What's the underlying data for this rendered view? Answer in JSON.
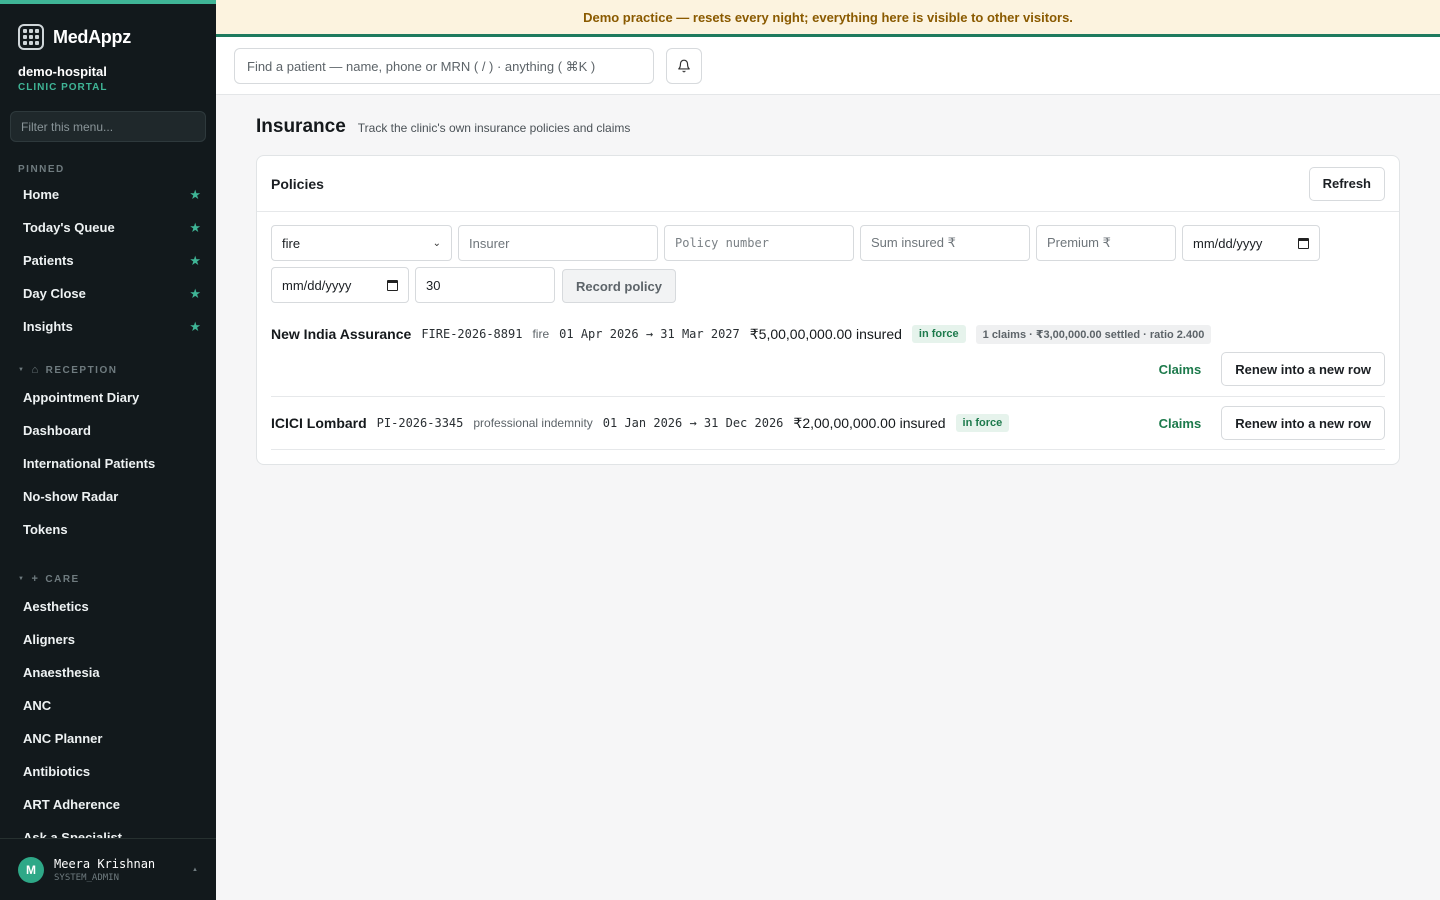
{
  "brand": {
    "name": "MedAppz"
  },
  "org": {
    "name": "demo-hospital",
    "subtitle": "CLINIC PORTAL"
  },
  "sidebar": {
    "filter_placeholder": "Filter this menu...",
    "pinned_label": "PINNED",
    "pinned": [
      "Home",
      "Today's Queue",
      "Patients",
      "Day Close",
      "Insights"
    ],
    "reception_label": "RECEPTION",
    "reception": [
      "Appointment Diary",
      "Dashboard",
      "International Patients",
      "No-show Radar",
      "Tokens"
    ],
    "care_label": "CARE",
    "care": [
      "Aesthetics",
      "Aligners",
      "Anaesthesia",
      "ANC",
      "ANC Planner",
      "Antibiotics",
      "ART Adherence",
      "Ask a Specialist"
    ]
  },
  "user": {
    "initial": "M",
    "name": "Meera Krishnan",
    "role": "SYSTEM_ADMIN"
  },
  "banner": {
    "text": "Demo practice — resets every night; everything here is visible to other visitors."
  },
  "topbar": {
    "search_placeholder": "Find a patient — name, phone or MRN ( / ) · anything ( ⌘K )"
  },
  "page": {
    "title": "Insurance",
    "subtitle": "Track the clinic's own insurance policies and claims"
  },
  "card": {
    "title": "Policies",
    "refresh_label": "Refresh",
    "form": {
      "type_value": "fire",
      "insurer_placeholder": "Insurer",
      "policy_placeholder": "Policy number",
      "sum_placeholder": "Sum insured ₹",
      "premium_placeholder": "Premium ₹",
      "date_placeholder": "mm/dd/yyyy",
      "days_value": "30",
      "record_label": "Record policy"
    },
    "policies": [
      {
        "insurer": "New India Assurance",
        "number": "FIRE-2026-8891",
        "type": "fire",
        "period": "01 Apr 2026 → 31 Mar 2027",
        "sum": "₹5,00,00,000.00 insured",
        "status": "in force",
        "claims_summary": "1 claims · ₹3,00,000.00 settled · ratio 2.400",
        "claims_link": "Claims",
        "renew_label": "Renew into a new row"
      },
      {
        "insurer": "ICICI Lombard",
        "number": "PI-2026-3345",
        "type": "professional indemnity",
        "period": "01 Jan 2026 → 31 Dec 2026",
        "sum": "₹2,00,00,000.00 insured",
        "status": "in force",
        "claims_link": "Claims",
        "renew_label": "Renew into a new row"
      }
    ]
  }
}
